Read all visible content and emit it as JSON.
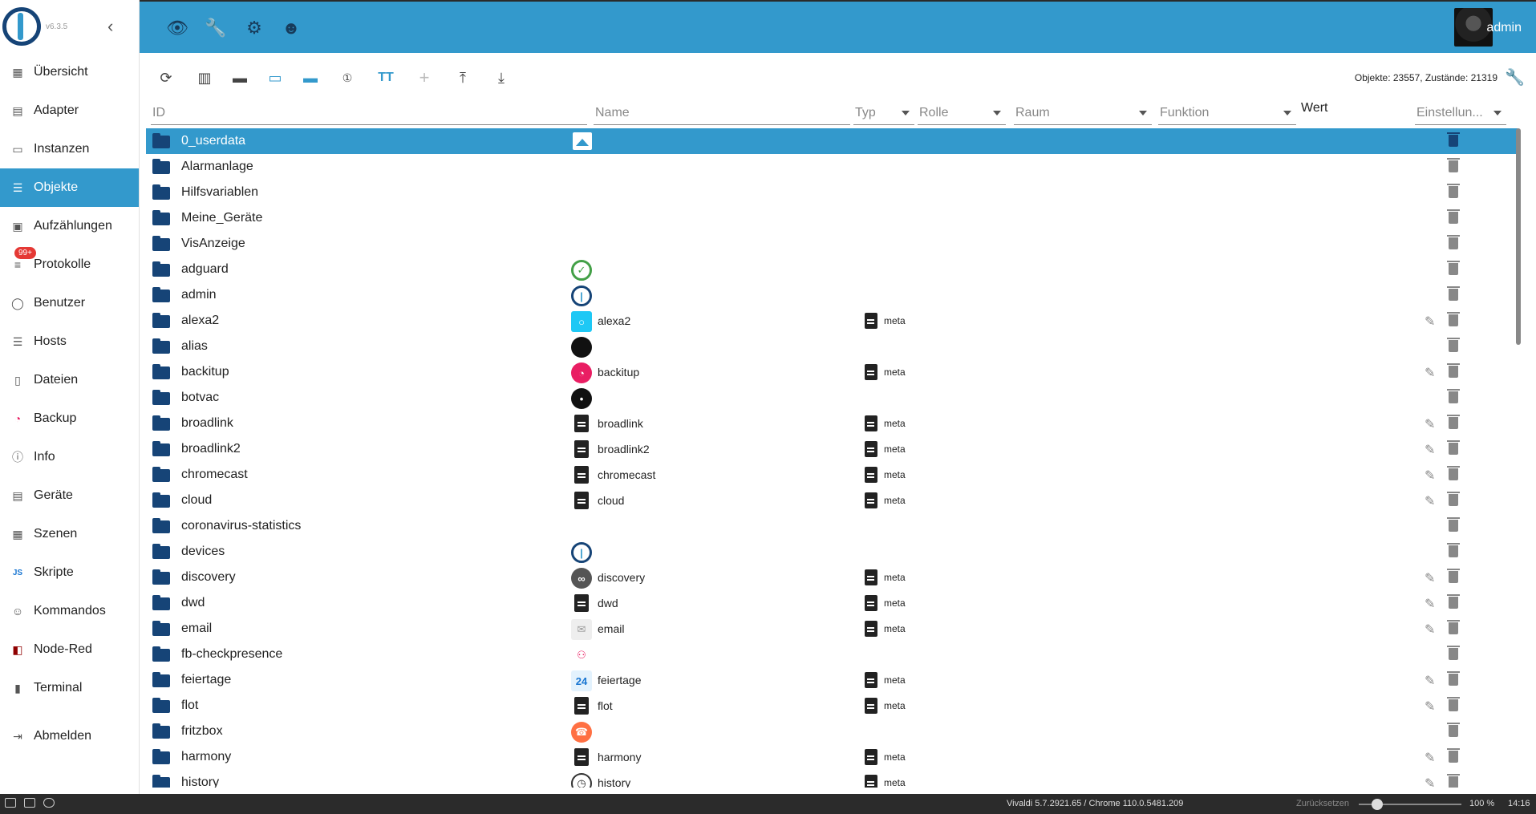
{
  "app": {
    "version": "v6.3.5",
    "user": "admin"
  },
  "sidebar": {
    "items": [
      {
        "label": "Übersicht",
        "icon": "grid-icon"
      },
      {
        "label": "Adapter",
        "icon": "store-icon"
      },
      {
        "label": "Instanzen",
        "icon": "instances-icon"
      },
      {
        "label": "Objekte",
        "icon": "list-icon",
        "active": true
      },
      {
        "label": "Aufzählungen",
        "icon": "enum-icon"
      },
      {
        "label": "Protokolle",
        "icon": "log-icon",
        "badge": "99+"
      },
      {
        "label": "Benutzer",
        "icon": "user-icon"
      },
      {
        "label": "Hosts",
        "icon": "hosts-icon"
      },
      {
        "label": "Dateien",
        "icon": "files-icon"
      },
      {
        "label": "Backup",
        "icon": "backup-icon"
      },
      {
        "label": "Info",
        "icon": "info-icon"
      },
      {
        "label": "Geräte",
        "icon": "devices-icon"
      },
      {
        "label": "Szenen",
        "icon": "scenes-icon"
      },
      {
        "label": "Skripte",
        "icon": "js-icon"
      },
      {
        "label": "Kommandos",
        "icon": "commands-icon"
      },
      {
        "label": "Node-Red",
        "icon": "nodered-icon"
      },
      {
        "label": "Terminal",
        "icon": "terminal-icon"
      },
      {
        "label": "Abmelden",
        "icon": "logout-icon"
      }
    ]
  },
  "toolbar": {
    "counts": "Objekte: 23557, Zustände: 21319"
  },
  "columns": {
    "id": "ID",
    "name": "Name",
    "type": "Typ",
    "role": "Rolle",
    "room": "Raum",
    "function": "Funktion",
    "value": "Wert",
    "settings": "Einstellun..."
  },
  "rows": [
    {
      "id": "0_userdata",
      "icon": "image-icon",
      "name": "",
      "meta": "",
      "edit": false
    },
    {
      "id": "Alarmanlage",
      "icon": "",
      "name": "",
      "meta": "",
      "edit": false
    },
    {
      "id": "Hilfsvariablen",
      "icon": "",
      "name": "",
      "meta": "",
      "edit": false
    },
    {
      "id": "Meine_Geräte",
      "icon": "",
      "name": "",
      "meta": "",
      "edit": false
    },
    {
      "id": "VisAnzeige",
      "icon": "",
      "name": "",
      "meta": "",
      "edit": false
    },
    {
      "id": "adguard",
      "icon": "adguard-icon",
      "name": "",
      "meta": "",
      "edit": false
    },
    {
      "id": "admin",
      "icon": "iobroker-icon",
      "name": "",
      "meta": "",
      "edit": false
    },
    {
      "id": "alexa2",
      "icon": "alexa-icon",
      "name": "alexa2",
      "meta": "meta",
      "edit": true
    },
    {
      "id": "alias",
      "icon": "bulb-icon",
      "name": "",
      "meta": "",
      "edit": false
    },
    {
      "id": "backitup",
      "icon": "backup-icon",
      "name": "backitup",
      "meta": "meta",
      "edit": true
    },
    {
      "id": "botvac",
      "icon": "robot-icon",
      "name": "",
      "meta": "",
      "edit": false
    },
    {
      "id": "broadlink",
      "icon": "document-icon",
      "name": "broadlink",
      "meta": "meta",
      "edit": true
    },
    {
      "id": "broadlink2",
      "icon": "document-icon",
      "name": "broadlink2",
      "meta": "meta",
      "edit": true
    },
    {
      "id": "chromecast",
      "icon": "document-icon",
      "name": "chromecast",
      "meta": "meta",
      "edit": true
    },
    {
      "id": "cloud",
      "icon": "document-icon",
      "name": "cloud",
      "meta": "meta",
      "edit": true
    },
    {
      "id": "coronavirus-statistics",
      "icon": "",
      "name": "",
      "meta": "",
      "edit": false
    },
    {
      "id": "devices",
      "icon": "iobroker-icon",
      "name": "",
      "meta": "",
      "edit": false
    },
    {
      "id": "discovery",
      "icon": "binoculars-icon",
      "name": "discovery",
      "meta": "meta",
      "edit": true
    },
    {
      "id": "dwd",
      "icon": "document-icon",
      "name": "dwd",
      "meta": "meta",
      "edit": true
    },
    {
      "id": "email",
      "icon": "email-icon",
      "name": "email",
      "meta": "meta",
      "edit": true
    },
    {
      "id": "fb-checkpresence",
      "icon": "people-icon",
      "name": "",
      "meta": "",
      "edit": false
    },
    {
      "id": "feiertage",
      "icon": "calendar-icon",
      "name": "feiertage",
      "meta": "meta",
      "edit": true
    },
    {
      "id": "flot",
      "icon": "document-icon",
      "name": "flot",
      "meta": "meta",
      "edit": true
    },
    {
      "id": "fritzbox",
      "icon": "phone-icon",
      "name": "",
      "meta": "",
      "edit": false
    },
    {
      "id": "harmony",
      "icon": "document-icon",
      "name": "harmony",
      "meta": "meta",
      "edit": true
    },
    {
      "id": "history",
      "icon": "clock-icon",
      "name": "history",
      "meta": "meta",
      "edit": true
    }
  ],
  "statusbar": {
    "browser": "Vivaldi 5.7.2921.65 / Chrome 110.0.5481.209",
    "reset": "Zurücksetzen",
    "zoom": "100 %",
    "time": "14:16"
  },
  "colors": {
    "accent": "#3399cc",
    "dark_blue": "#164477",
    "badge": "#e53935"
  }
}
